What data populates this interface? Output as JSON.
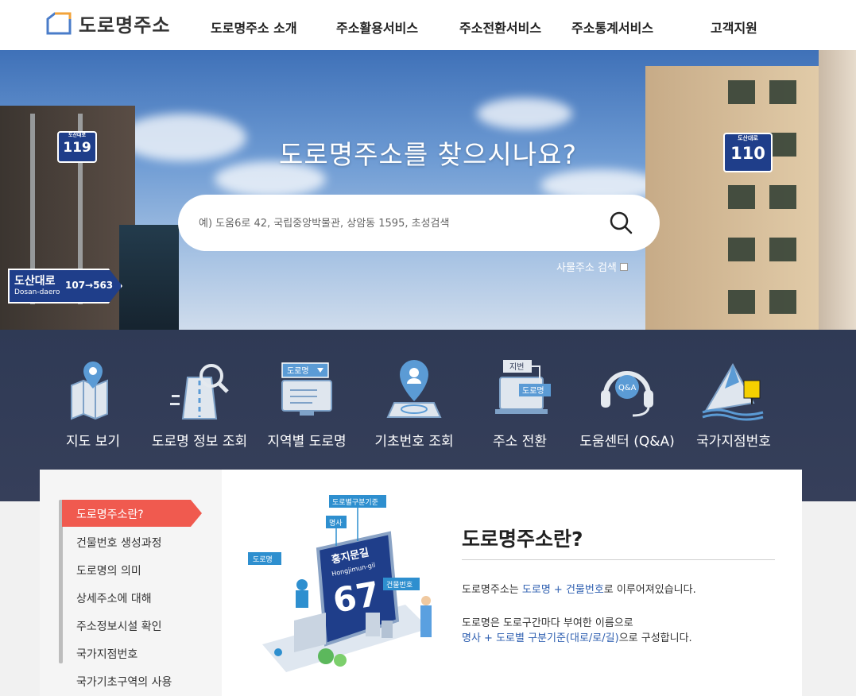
{
  "header": {
    "logo_text": "도로명주소",
    "nav": [
      "도로명주소 소개",
      "주소활용서비스",
      "주소전환서비스",
      "주소통계서비스",
      "고객지원"
    ]
  },
  "hero": {
    "title": "도로명주소를 찾으시나요?",
    "search_placeholder": "예) 도움6로 42, 국립중앙박물관, 상암동 1595, 초성검색",
    "building_search_label": "사물주소 검색",
    "sign_left_num": "119",
    "sign_left_name": "도산대로",
    "sign_right_num": "110",
    "sign_right_name": "도산대로",
    "road_sign_name": "도산대로",
    "road_sign_roman": "Dosan-daero",
    "road_sign_range": "107→563"
  },
  "quick_menu": [
    {
      "label": "지도 보기",
      "icon": "map-icon"
    },
    {
      "label": "도로명 정보 조회",
      "icon": "road-search-icon"
    },
    {
      "label": "지역별 도로명",
      "icon": "region-road-icon",
      "badge": "도로명"
    },
    {
      "label": "기초번호 조회",
      "icon": "location-pin-icon"
    },
    {
      "label": "주소 전환",
      "icon": "address-convert-icon",
      "badge_top": "지번",
      "badge_bottom": "도로명"
    },
    {
      "label": "도움센터 (Q&A)",
      "icon": "headset-icon",
      "badge": "Q&A"
    },
    {
      "label": "국가지점번호",
      "icon": "mountain-sign-icon"
    }
  ],
  "sidebar": {
    "active": "도로명주소란?",
    "items": [
      "건물번호 생성과정",
      "도로명의 의미",
      "상세주소에 대해",
      "주소정보시설 확인",
      "국가지점번호",
      "국가기초구역의 사용"
    ]
  },
  "illustration": {
    "label_standard": "도로별구분기준",
    "label_name": "명사",
    "label_road": "도로명",
    "label_building": "건물번호",
    "sign_name": "홍지문길",
    "sign_roman": "Hongjimun-gil",
    "sign_number": "67"
  },
  "content": {
    "title": "도로명주소란?",
    "p1_a": "도로명주소는 ",
    "p1_hl": "도로명 + 건물번호",
    "p1_b": "로 이루어져있습니다.",
    "p2_line1": "도로명은 도로구간마다 부여한 이름으로",
    "p2_hl": "명사 + 도로별 구분기준(대로/로/길)",
    "p2_b": "으로 구성합니다."
  },
  "colors": {
    "accent": "#f05a4f",
    "sign_blue": "#1f3e8a",
    "highlight": "#2e5fb0",
    "logo_blue": "#4a7cc9",
    "logo_orange": "#f2a33a"
  }
}
